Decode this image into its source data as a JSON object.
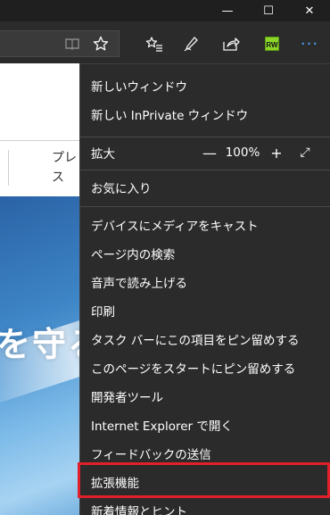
{
  "titlebar": {
    "minimize_glyph": "—",
    "maximize_glyph": "☐",
    "close_glyph": "✕"
  },
  "toolbar": {
    "reading_view_icon": "book-icon",
    "favorite_icon": "star-icon",
    "hub_icon": "favorites-hub-icon",
    "notes_icon": "pen-icon",
    "share_icon": "share-icon",
    "extension_icon": "rw-extension-icon",
    "extension_badge": "RW",
    "more_icon": "ellipsis-icon",
    "more_glyph": "···",
    "accent_color": "#3c8ce7"
  },
  "page": {
    "nav_text": "プレス",
    "hero_text": "を守る"
  },
  "menu": {
    "items": [
      {
        "label": "新しいウィンドウ"
      },
      {
        "label": "新しい InPrivate ウィンドウ"
      },
      {
        "label": "拡大"
      },
      {
        "label": "お気に入り"
      },
      {
        "label": "デバイスにメディアをキャスト"
      },
      {
        "label": "ページ内の検索"
      },
      {
        "label": "音声で読み上げる"
      },
      {
        "label": "印刷"
      },
      {
        "label": "タスク バーにこの項目をピン留めする"
      },
      {
        "label": "このページをスタートにピン留めする"
      },
      {
        "label": "開発者ツール"
      },
      {
        "label": "Internet Explorer で開く"
      },
      {
        "label": "フィードバックの送信"
      },
      {
        "label": "拡張機能"
      },
      {
        "label": "新着情報とヒント"
      }
    ],
    "zoom": {
      "minus": "—",
      "value": "100%",
      "plus": "+",
      "fullscreen": "⤢"
    },
    "highlighted_item": "拡張機能",
    "highlight_color": "#e0202a"
  }
}
